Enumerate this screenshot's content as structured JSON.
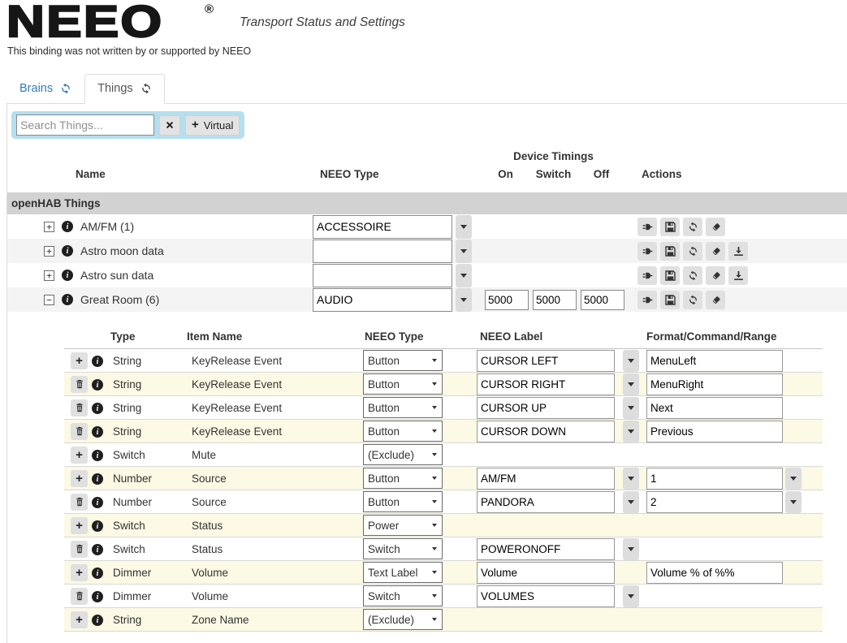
{
  "header": {
    "logo": "NEEO",
    "registered": "®",
    "subtitle": "Transport Status and Settings",
    "disclaimer": "This binding was not written by or supported by NEEO"
  },
  "tabs": [
    {
      "label": "Brains",
      "active": false
    },
    {
      "label": "Things",
      "active": true
    }
  ],
  "search": {
    "placeholder": "Search Things...",
    "virtual_label": "Virtual"
  },
  "things_table": {
    "headers": {
      "name": "Name",
      "neeo_type": "NEEO Type",
      "device_timings": "Device Timings",
      "on": "On",
      "switch": "Switch",
      "off": "Off",
      "actions": "Actions"
    },
    "group": "openHAB Things",
    "rows": [
      {
        "expand": "collapsed",
        "name": "AM/FM (1)",
        "neeo_type": "ACCESSOIRE",
        "timings": null,
        "actions": [
          "plug-icon",
          "save-icon",
          "refresh-icon",
          "eraser-icon"
        ]
      },
      {
        "expand": "collapsed",
        "name": "Astro moon data",
        "neeo_type": "",
        "timings": null,
        "actions": [
          "plug-icon",
          "save-icon",
          "refresh-icon",
          "eraser-icon",
          "download-icon"
        ]
      },
      {
        "expand": "collapsed",
        "name": "Astro sun data",
        "neeo_type": "",
        "timings": null,
        "actions": [
          "plug-icon",
          "save-icon",
          "refresh-icon",
          "eraser-icon",
          "download-icon"
        ]
      },
      {
        "expand": "expanded",
        "name": "Great Room (6)",
        "neeo_type": "AUDIO",
        "timings": {
          "on": "5000",
          "switch": "5000",
          "off": "5000"
        },
        "actions": [
          "plug-icon",
          "save-icon",
          "refresh-icon",
          "eraser-icon"
        ]
      }
    ]
  },
  "channels_table": {
    "headers": {
      "type": "Type",
      "item_name": "Item Name",
      "neeo_type": "NEEO Type",
      "neeo_label": "NEEO Label",
      "format": "Format/Command/Range"
    },
    "rows": [
      {
        "action": "add",
        "type": "String",
        "item": "KeyRelease Event",
        "neeo_type": "Button",
        "label": "CURSOR LEFT",
        "label_dropdown": true,
        "format": "MenuLeft",
        "format_dropdown": false
      },
      {
        "action": "delete",
        "type": "String",
        "item": "KeyRelease Event",
        "neeo_type": "Button",
        "label": "CURSOR RIGHT",
        "label_dropdown": true,
        "format": "MenuRight",
        "format_dropdown": false
      },
      {
        "action": "delete",
        "type": "String",
        "item": "KeyRelease Event",
        "neeo_type": "Button",
        "label": "CURSOR UP",
        "label_dropdown": true,
        "format": "Next",
        "format_dropdown": false
      },
      {
        "action": "delete",
        "type": "String",
        "item": "KeyRelease Event",
        "neeo_type": "Button",
        "label": "CURSOR DOWN",
        "label_dropdown": true,
        "format": "Previous",
        "format_dropdown": false
      },
      {
        "action": "add",
        "type": "Switch",
        "item": "Mute",
        "neeo_type": "(Exclude)",
        "label": "",
        "label_dropdown": false,
        "format": "",
        "format_dropdown": false
      },
      {
        "action": "add",
        "type": "Number",
        "item": "Source",
        "neeo_type": "Button",
        "label": "AM/FM",
        "label_dropdown": true,
        "format": "1",
        "format_dropdown": true
      },
      {
        "action": "delete",
        "type": "Number",
        "item": "Source",
        "neeo_type": "Button",
        "label": "PANDORA",
        "label_dropdown": true,
        "format": "2",
        "format_dropdown": true
      },
      {
        "action": "add",
        "type": "Switch",
        "item": "Status",
        "neeo_type": "Power",
        "label": "",
        "label_dropdown": false,
        "format": "",
        "format_dropdown": false
      },
      {
        "action": "delete",
        "type": "Switch",
        "item": "Status",
        "neeo_type": "Switch",
        "label": "POWERONOFF",
        "label_dropdown": true,
        "format": "",
        "format_dropdown": false
      },
      {
        "action": "add",
        "type": "Dimmer",
        "item": "Volume",
        "neeo_type": "Text Label",
        "label": "Volume",
        "label_dropdown": false,
        "format": "Volume % of %%",
        "format_dropdown": false
      },
      {
        "action": "delete",
        "type": "Dimmer",
        "item": "Volume",
        "neeo_type": "Switch",
        "label": "VOLUMES",
        "label_dropdown": true,
        "format": "",
        "format_dropdown": false
      },
      {
        "action": "add",
        "type": "String",
        "item": "Zone Name",
        "neeo_type": "(Exclude)",
        "label": "",
        "label_dropdown": false,
        "format": "",
        "format_dropdown": false
      }
    ]
  },
  "colors": {
    "accent_blue": "#337ab7",
    "search_panel": "#b5dfef",
    "row_alt_yellow": "#fcf9e4",
    "row_alt_gray": "#f4f4f4",
    "group_header_bg": "#d2d2d2",
    "button_bg": "#e0e0e0"
  }
}
